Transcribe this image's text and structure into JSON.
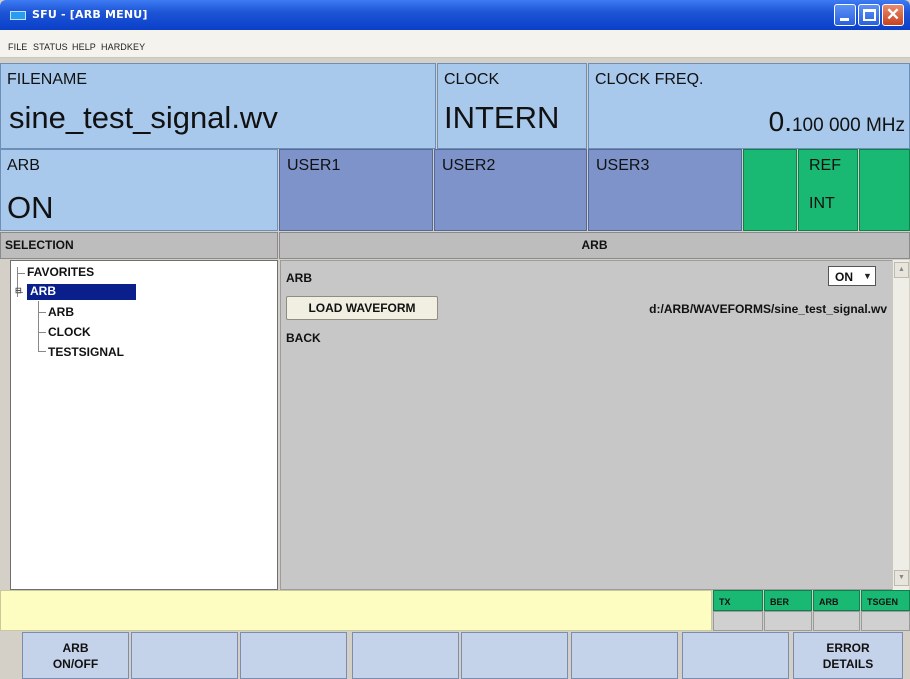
{
  "window": {
    "title": "SFU - [ARB MENU]"
  },
  "menu": [
    "FILE",
    "STATUS",
    "HELP",
    "HARDKEY"
  ],
  "header": {
    "filename": {
      "label": "FILENAME",
      "value": "sine_test_signal.wv"
    },
    "clock": {
      "label": "CLOCK",
      "value": "INTERN"
    },
    "clock_freq": {
      "label": "CLOCK FREQ.",
      "value_main": "0.",
      "value_rest": "100 000 MHz"
    },
    "arb": {
      "label": "ARB",
      "value": "ON"
    },
    "users": [
      "USER1",
      "USER2",
      "USER3"
    ],
    "ref": {
      "label": "REF",
      "value": "INT"
    }
  },
  "selection": {
    "title": "SELECTION",
    "tree": [
      {
        "label": "FAVORITES"
      },
      {
        "label": "ARB",
        "selected": true
      },
      {
        "label": "ARB"
      },
      {
        "label": "CLOCK"
      },
      {
        "label": "TESTSIGNAL"
      }
    ]
  },
  "arb_panel": {
    "title": "ARB",
    "arb_label": "ARB",
    "arb_state": "ON",
    "load_button": "LOAD WAVEFORM",
    "waveform_path": "d:/ARB/WAVEFORMS/sine_test_signal.wv",
    "back_label": "BACK"
  },
  "status_tags": [
    "TX",
    "BER",
    "ARB",
    "TSGEN"
  ],
  "softkeys": [
    {
      "line1": "ARB",
      "line2": "ON/OFF"
    },
    {
      "line1": "",
      "line2": ""
    },
    {
      "line1": "",
      "line2": ""
    },
    {
      "line1": "",
      "line2": ""
    },
    {
      "line1": "",
      "line2": ""
    },
    {
      "line1": "",
      "line2": ""
    },
    {
      "line1": "",
      "line2": ""
    },
    {
      "line1": "ERROR",
      "line2": "DETAILS"
    }
  ],
  "colors": {
    "header_blue": "#a8c8ec",
    "user_blue": "#7e93c9",
    "status_green": "#19b873",
    "tree_selection": "#0a1e8c",
    "softkey": "#c4d2ea"
  }
}
